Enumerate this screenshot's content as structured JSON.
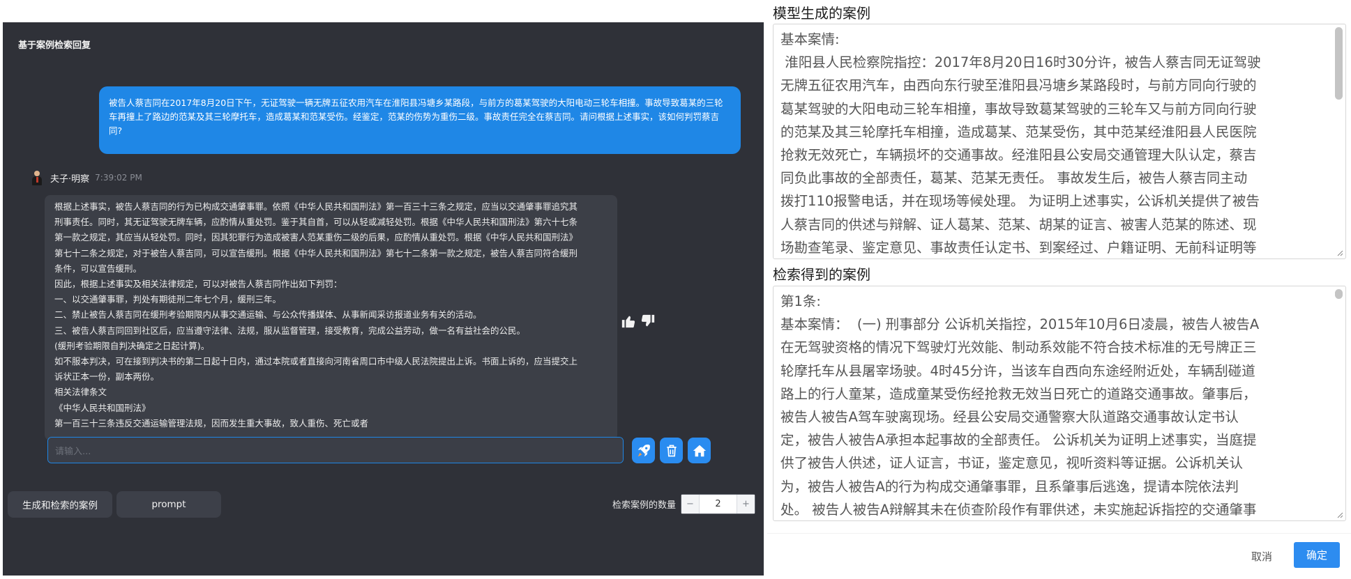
{
  "chat": {
    "title": "基于案例检索回复",
    "user_message": "被告人蔡吉同在2017年8月20日下午，无证驾驶一辆无牌五征农用汽车在淮阳县冯塘乡某路段，与前方的葛某驾驶的大阳电动三轮车相撞。事故导致葛某的三轮车再撞上了路边的范某及其三轮摩托车，造成葛某和范某受伤。经鉴定，范某的伤势为重伤二级。事故责任完全在蔡吉同。请问根据上述事实，该如何判罚蔡吉同?",
    "bot_name": "夫子·明察",
    "bot_time": "7:39:02 PM",
    "bot_lines": [
      "根据上述事实，被告人蔡吉同的行为已构成交通肇事罪。依照《中华人民共和国刑法》第一百三十三条之规定，应当以交通肇事罪追究其",
      "刑事责任。同时，其无证驾驶无牌车辆，应酌情从重处罚。鉴于其自首，可以从轻或减轻处罚。根据《中华人民共和国刑法》第六十七条",
      "第一款之规定，其应当从轻处罚。同时，因其犯罪行为造成被害人范某重伤二级的后果，应酌情从重处罚。根据《中华人民共和国刑法》",
      "第七十二条之规定，对于被告人蔡吉同，可以宣告缓刑。根据《中华人民共和国刑法》第七十二条第一款之规定，被告人蔡吉同符合缓刑",
      "条件，可以宣告缓刑。",
      "因此，根据上述事实及相关法律规定，可以对被告人蔡吉同作出如下判罚：",
      "一、以交通肇事罪，判处有期徒刑二年七个月，缓刑三年。",
      "二、禁止被告人蔡吉同在缓刑考验期限内从事交通运输、与公众传播媒体、从事新闻采访报道业务有关的活动。",
      "三、被告人蔡吉同回到社区后，应当遵守法律、法规，服从监督管理，接受教育，完成公益劳动，做一名有益社会的公民。",
      "(缓刑考验期限自判决确定之日起计算)。",
      "如不服本判决，可在接到判决书的第二日起十日内，通过本院或者直接向河南省周口市中级人民法院提出上诉。书面上诉的，应当提交上",
      "诉状正本一份，副本两份。",
      "相关法律条文",
      "《中华人民共和国刑法》",
      "第一百三十三条违反交通运输管理法规，因而发生重大事故，致人重伤、死亡或者"
    ],
    "input_placeholder": "请输入...",
    "tabs": [
      "生成和检索的案例",
      "prompt"
    ],
    "count_label": "检索案例的数量",
    "count_value": "2",
    "minus_symbol": "−",
    "plus_symbol": "+"
  },
  "dialog": {
    "generated_title": "模型生成的案例",
    "generated_lines": [
      "基本案情:",
      " 淮阳县人民检察院指控：2017年8月20日16时30分许，被告人蔡吉同无证驾驶",
      "无牌五征农用汽车，由西向东行驶至淮阳县冯塘乡某路段时，与前方同向行驶的",
      "葛某驾驶的大阳电动三轮车相撞，事故导致葛某驾驶的三轮车又与前方同向行驶",
      "的范某及其三轮摩托车相撞，造成葛某、范某受伤，其中范某经淮阳县人民医院",
      "抢救无效死亡，车辆损坏的交通事故。经淮阳县公安局交通管理大队认定，蔡吉",
      "同负此事故的全部责任，葛某、范某无责任。 事故发生后，被告人蔡吉同主动",
      "拨打110报警电话，并在现场等候处理。 为证明上述事实，公诉机关提供了被告",
      "人蔡吉同的供述与辩解、证人葛某、范某、胡某的证言、被害人范某的陈述、现",
      "场勘查笔录、鉴定意见、事故责任认定书、到案经过、户籍证明、无前科证明等"
    ],
    "retrieved_title": "检索得到的案例",
    "retrieved_lines": [
      "第1条:",
      "基本案情：  (一) 刑事部分 公诉机关指控，2015年10月6日凌晨，被告人被告A",
      "在无驾驶资格的情况下驾驶灯光效能、制动系效能不符合技术标准的无号牌正三",
      "轮摩托车从县屠宰场驶。4时45分许，当该车自西向东途经附近处，车辆刮碰道",
      "路上的行人童某，造成童某受伤经抢救无效当日死亡的道路交通事故。肇事后，",
      "被告人被告A驾车驶离现场。经县公安局交通警察大队道路交通事故认定书认",
      "定，被告人被告A承担本起事故的全部责任。 公诉机关为证明上述事实，当庭提",
      "供了被告人供述，证人证言，书证，鉴定意见，视听资料等证据。公诉机关认",
      "为，被告人被告A的行为构成交通肇事罪，且系肇事后逃逸，提请本院依法判",
      "处。 被告人被告A辩解其未在侦查阶段作有罪供述，未实施起诉指控的交通肇事"
    ],
    "cancel_label": "取消",
    "confirm_label": "确定"
  },
  "icons": {
    "send": "rocket-icon",
    "delete": "trash-icon",
    "home": "home-icon",
    "like": "thumbs-up-icon",
    "dislike": "thumbs-down-icon"
  },
  "colors": {
    "chat_background": "#2f3138",
    "user_bubble": "#1f87e6",
    "bot_bubble": "#3c3f47",
    "accent": "#2d8cf0"
  }
}
